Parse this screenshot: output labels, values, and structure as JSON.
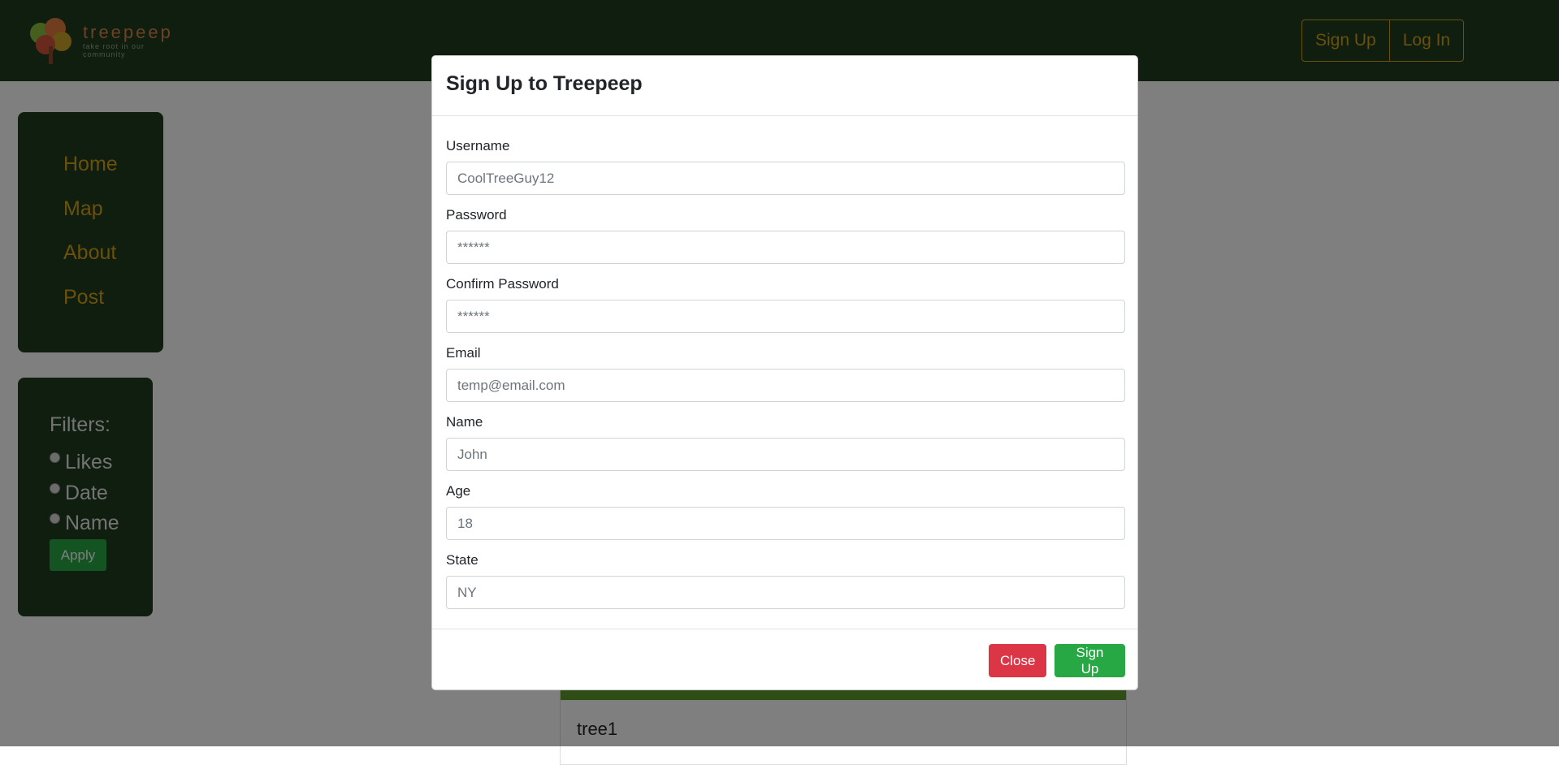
{
  "brand": {
    "name": "treepeep",
    "tagline": "take root in our community"
  },
  "header": {
    "signup_label": "Sign Up",
    "login_label": "Log In"
  },
  "nav": {
    "items": [
      {
        "label": "Home"
      },
      {
        "label": "Map"
      },
      {
        "label": "About"
      },
      {
        "label": "Post"
      }
    ]
  },
  "filters": {
    "title": "Filters:",
    "options": [
      {
        "label": "Likes"
      },
      {
        "label": "Date"
      },
      {
        "label": "Name"
      }
    ],
    "apply_label": "Apply"
  },
  "post": {
    "title": "tree1"
  },
  "modal": {
    "title": "Sign Up to Treepeep",
    "fields": [
      {
        "label": "Username",
        "placeholder": "CoolTreeGuy12"
      },
      {
        "label": "Password",
        "placeholder": "******"
      },
      {
        "label": "Confirm Password",
        "placeholder": "******"
      },
      {
        "label": "Email",
        "placeholder": "temp@email.com"
      },
      {
        "label": "Name",
        "placeholder": "John"
      },
      {
        "label": "Age",
        "placeholder": "18"
      },
      {
        "label": "State",
        "placeholder": "NY"
      }
    ],
    "close_label": "Close",
    "submit_label": "Sign Up"
  },
  "colors": {
    "header_bg": "#1f3d1e",
    "accent_gold": "#d4a017",
    "success": "#28a745",
    "danger": "#dc3545"
  }
}
